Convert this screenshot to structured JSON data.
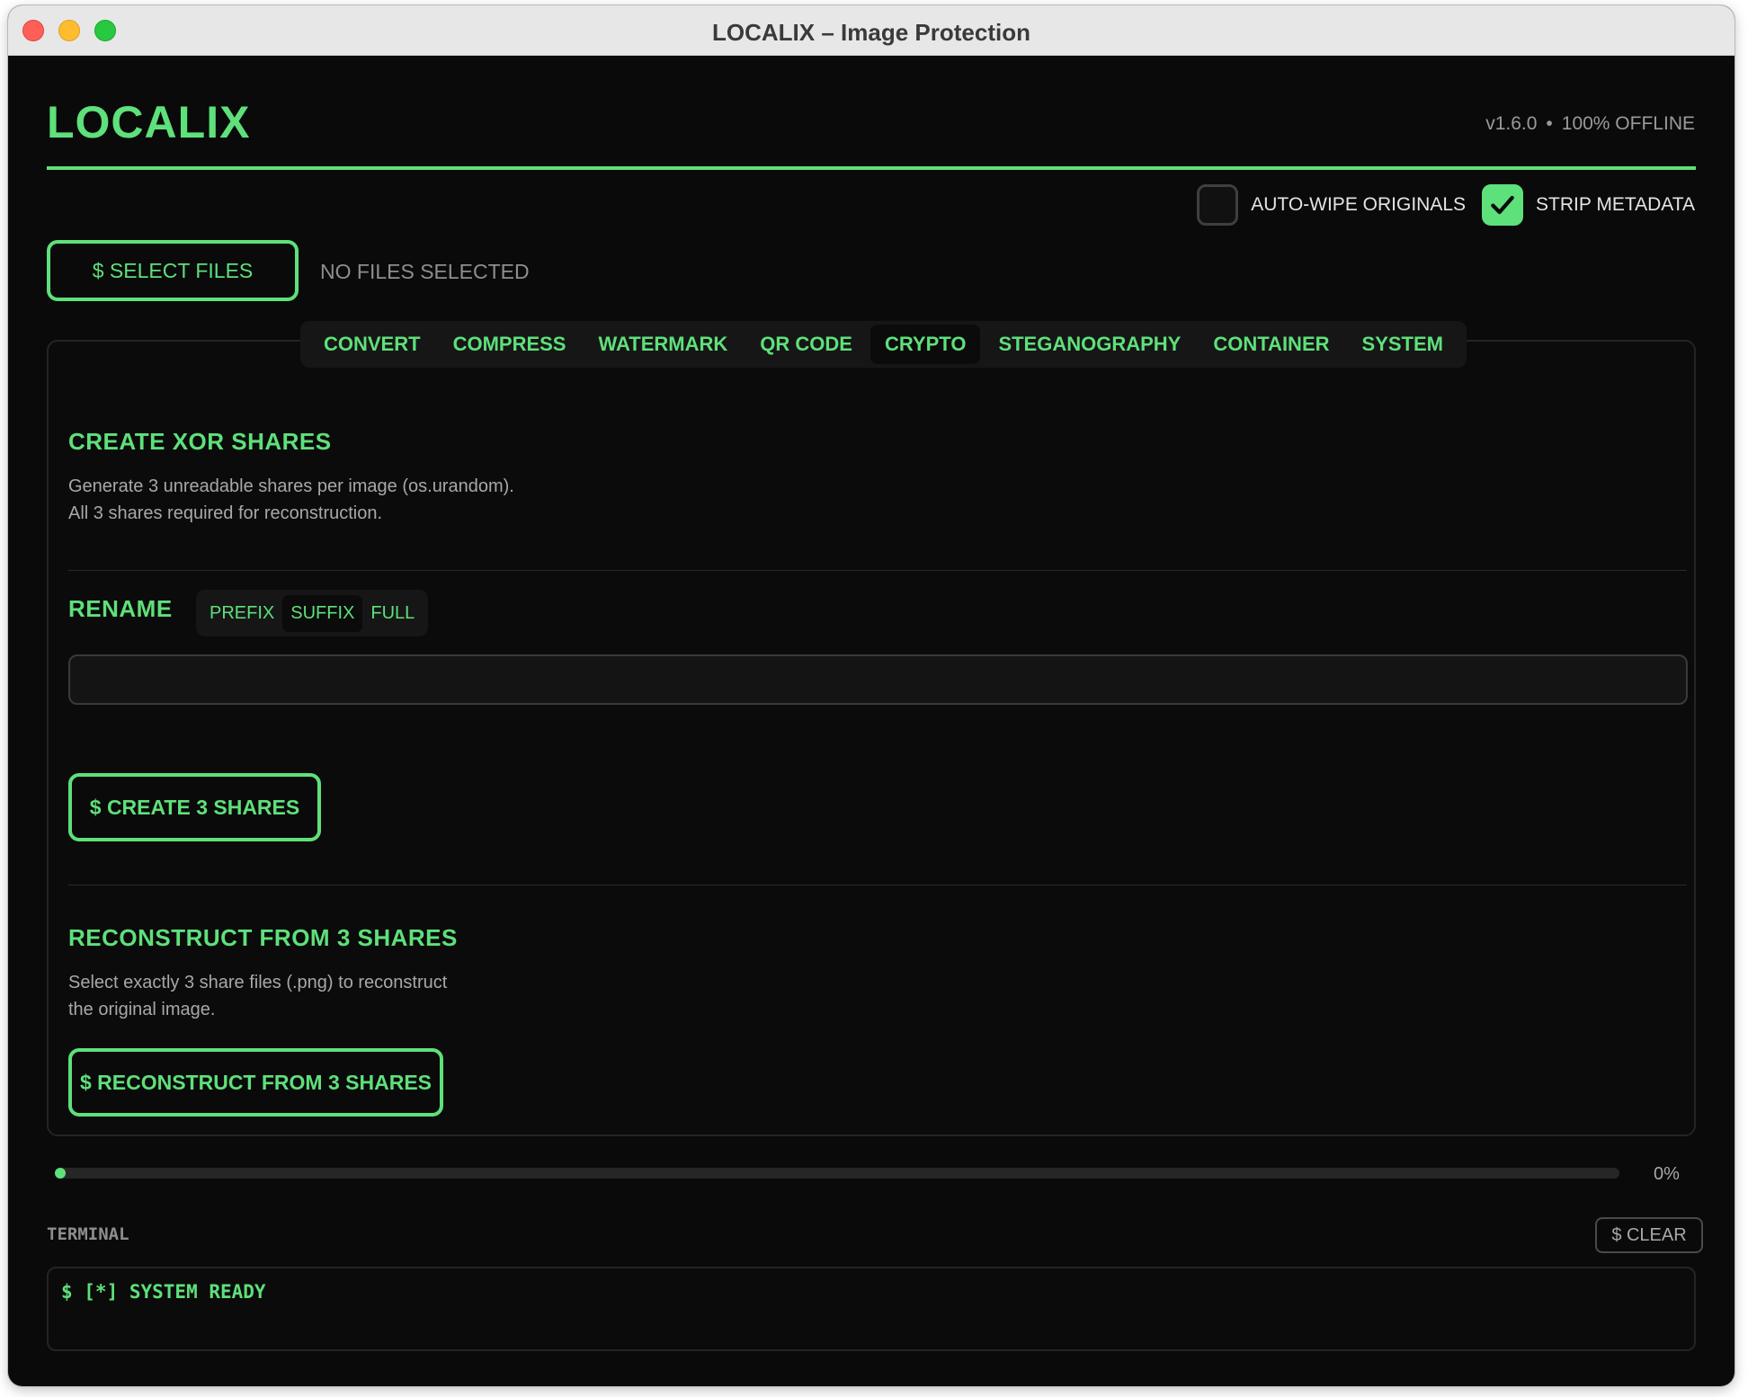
{
  "window": {
    "title": "LOCALIX – Image Protection"
  },
  "header": {
    "logo": "LOCALIX",
    "version": "v1.6.0",
    "separator": "•",
    "mode": "100% OFFLINE"
  },
  "options": {
    "auto_wipe": {
      "label": "AUTO-WIPE ORIGINALS",
      "checked": false
    },
    "strip_metadata": {
      "label": "STRIP METADATA",
      "checked": true
    }
  },
  "file_picker": {
    "button_label": "$ SELECT FILES",
    "status": "NO FILES SELECTED"
  },
  "tabs": {
    "active": "CRYPTO",
    "items": [
      {
        "label": "CONVERT"
      },
      {
        "label": "COMPRESS"
      },
      {
        "label": "WATERMARK"
      },
      {
        "label": "QR CODE"
      },
      {
        "label": "CRYPTO"
      },
      {
        "label": "STEGANOGRAPHY"
      },
      {
        "label": "CONTAINER"
      },
      {
        "label": "SYSTEM"
      }
    ]
  },
  "create_shares": {
    "title": "CREATE XOR SHARES",
    "desc_line1": "Generate 3 unreadable shares per image (os.urandom).",
    "desc_line2": "All 3 shares required for reconstruction.",
    "button_label": "$ CREATE 3 SHARES"
  },
  "rename": {
    "title": "RENAME",
    "modes": [
      "PREFIX",
      "SUFFIX",
      "FULL"
    ],
    "active_mode": "SUFFIX",
    "value": ""
  },
  "reconstruct": {
    "title": "RECONSTRUCT FROM 3 SHARES",
    "desc_line1": "Select exactly 3 share files (.png) to reconstruct",
    "desc_line2": "the original image.",
    "button_label": "$ RECONSTRUCT FROM 3 SHARES"
  },
  "progress": {
    "percent_label": "0%",
    "value": 0
  },
  "terminal": {
    "label": "TERMINAL",
    "clear_label": "$ CLEAR",
    "lines": [
      "$ [*] SYSTEM READY"
    ]
  },
  "colors": {
    "accent": "#5ee07a",
    "background": "#0a0a0a"
  }
}
